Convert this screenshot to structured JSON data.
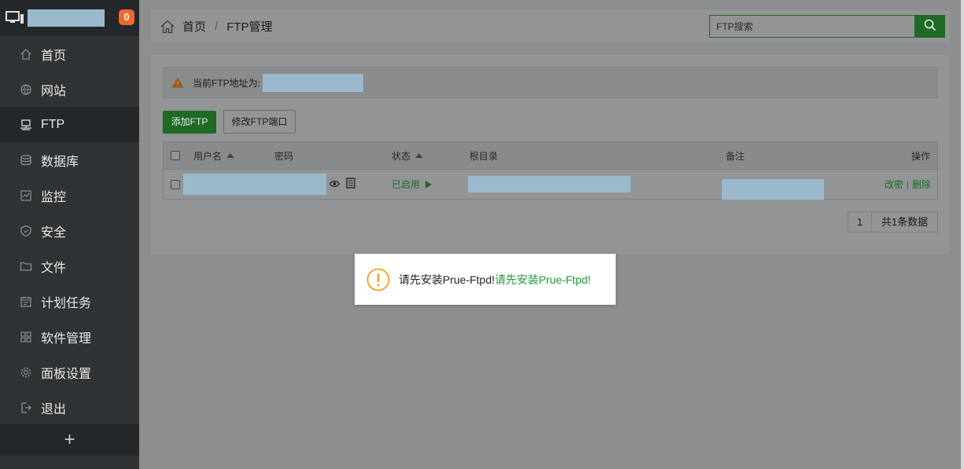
{
  "sidebar": {
    "notification_count": "0",
    "items": [
      {
        "label": "首页",
        "icon": "home-icon"
      },
      {
        "label": "网站",
        "icon": "globe-icon"
      },
      {
        "label": "FTP",
        "icon": "ftp-icon"
      },
      {
        "label": "数据库",
        "icon": "database-icon"
      },
      {
        "label": "监控",
        "icon": "monitor-icon"
      },
      {
        "label": "安全",
        "icon": "shield-icon"
      },
      {
        "label": "文件",
        "icon": "folder-icon"
      },
      {
        "label": "计划任务",
        "icon": "calendar-icon"
      },
      {
        "label": "软件管理",
        "icon": "apps-icon"
      },
      {
        "label": "面板设置",
        "icon": "gear-icon"
      },
      {
        "label": "退出",
        "icon": "logout-icon"
      }
    ],
    "add_label": "+"
  },
  "header": {
    "breadcrumb_home": "首页",
    "breadcrumb_sep": "/",
    "breadcrumb_current": "FTP管理",
    "search_placeholder": "FTP搜索"
  },
  "notice": {
    "text": "当前FTP地址为:"
  },
  "toolbar": {
    "add_label": "添加FTP",
    "port_label": "修改FTP端口"
  },
  "table": {
    "columns": [
      "用户名",
      "密码",
      "状态",
      "根目录",
      "备注",
      "操作"
    ],
    "rows": [
      {
        "status": "已启用",
        "actions": [
          "改密",
          "删除"
        ]
      }
    ]
  },
  "pagination": {
    "page": "1",
    "total": "共1条数据"
  },
  "toast": {
    "message": "请先安装Prue-Ftpd!",
    "message_highlight": "请先安装Prue-Ftpd!"
  },
  "colors": {
    "sidebar_bg": "#2f3335",
    "accent_green": "#1d6b25",
    "badge_orange": "#f2682b",
    "masked_blue": "#9bb9cd"
  }
}
